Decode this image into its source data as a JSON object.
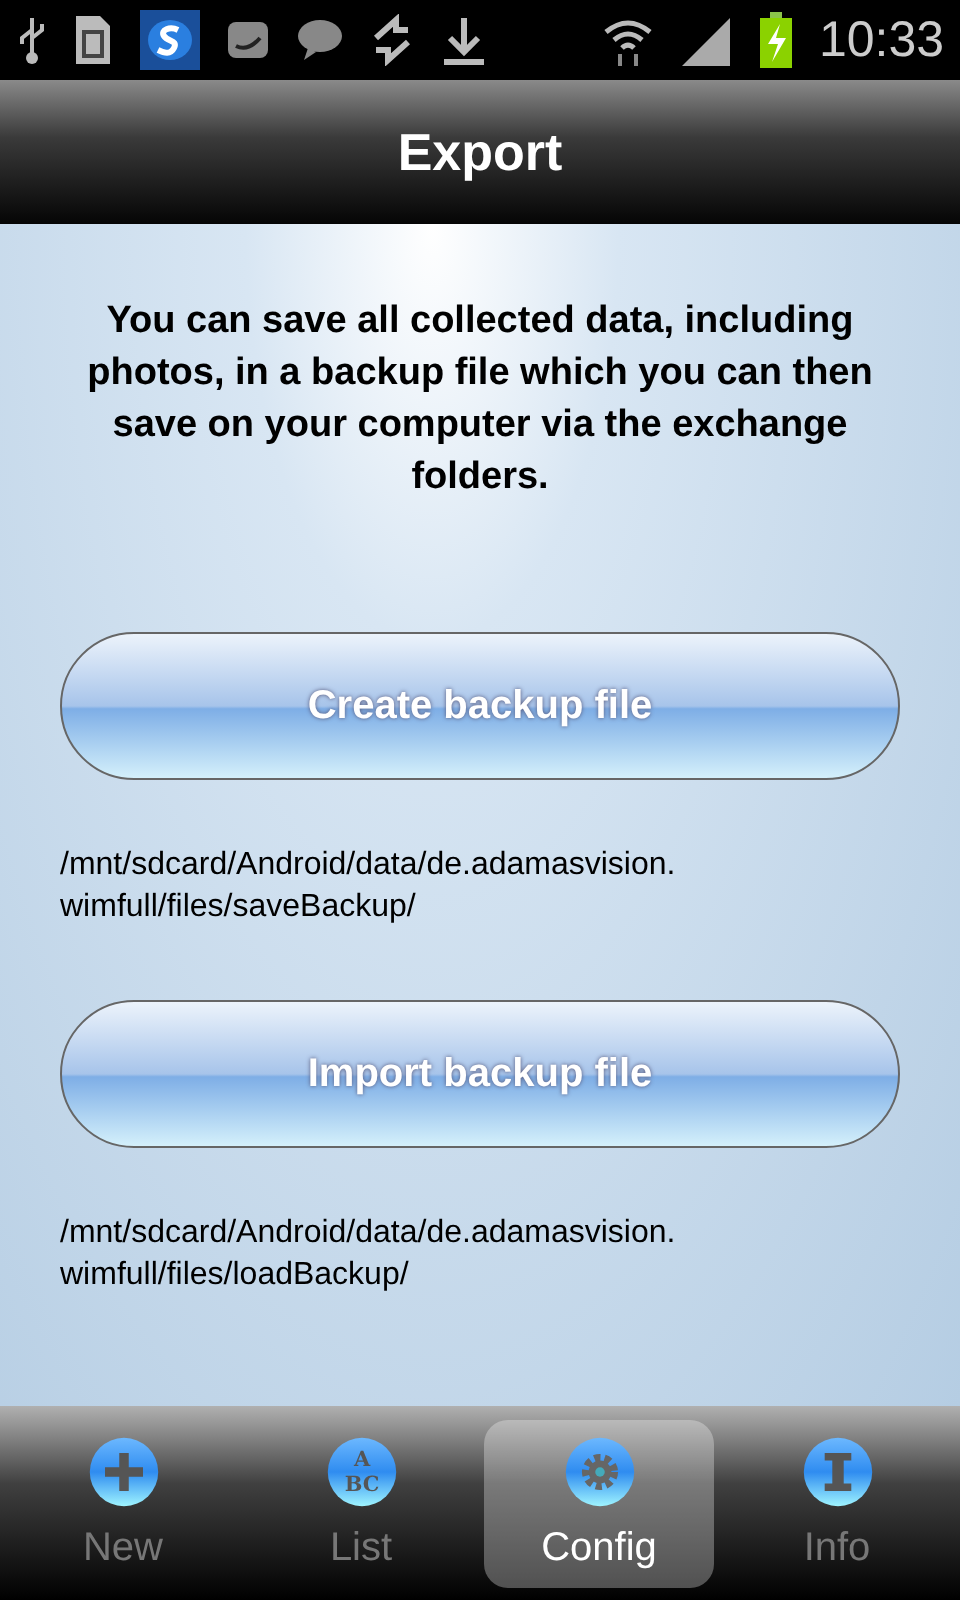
{
  "status_bar": {
    "time": "10:33"
  },
  "title": "Export",
  "intro": "You can save all collected data, including photos, in a backup file which you can then save on your computer via the exchange folders.",
  "actions": [
    {
      "label": "Create backup file",
      "path": "/mnt/sdcard/Android/data/de.adamasvision.\nwimfull/files/saveBackup/"
    },
    {
      "label": "Import backup file",
      "path": "/mnt/sdcard/Android/data/de.adamasvision.\nwimfull/files/loadBackup/"
    }
  ],
  "tabs": [
    {
      "label": "New",
      "kind": "plus",
      "selected": false
    },
    {
      "label": "List",
      "kind": "letters",
      "letters": [
        "A",
        "BC"
      ],
      "selected": false
    },
    {
      "label": "Config",
      "kind": "gear",
      "selected": true
    },
    {
      "label": "Info",
      "kind": "info",
      "selected": false
    }
  ]
}
